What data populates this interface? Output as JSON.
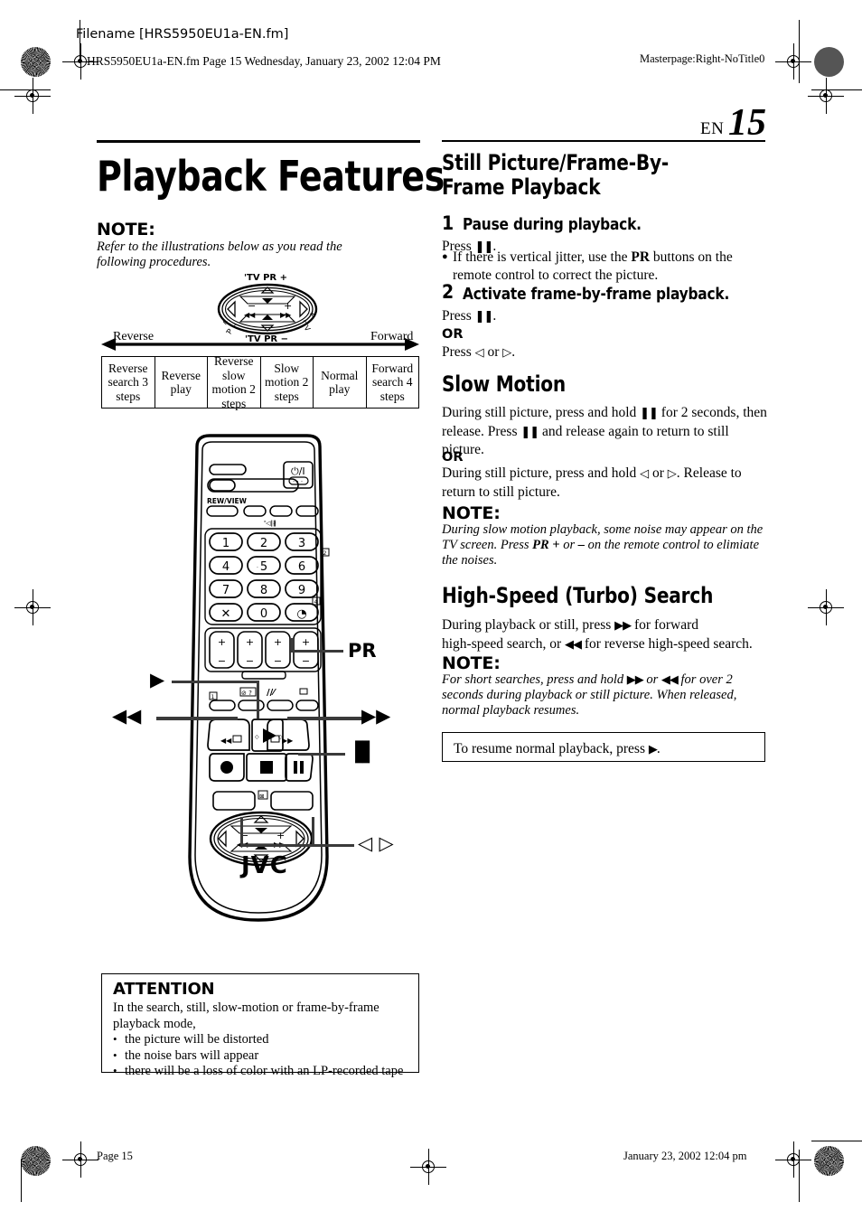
{
  "print_marks": {
    "header_filename": "Filename [HRS5950EU1a-EN.fm]",
    "header_fileinfo": "HRS5950EU1a-EN.fm  Page 15  Wednesday, January 23, 2002  12:04 PM",
    "header_masterpage": "Masterpage:Right-NoTitle0",
    "footer_page": "Page 15",
    "footer_date": "January 23, 2002 12:04 pm"
  },
  "page_header": {
    "lang": "EN",
    "page_number": "15"
  },
  "left_column": {
    "title": "Playback Features",
    "note_heading": "NOTE:",
    "note_body": "Refer to the illustrations below as you read the following procedures.",
    "diagram": {
      "pad_labels_top": "'TV PR +",
      "pad_labels_bottom": "'TV PR –",
      "pad_left_minus": "–",
      "pad_right_plus": "+",
      "axis_left_label": "Reverse",
      "axis_right_label": "Forward",
      "table_cells": [
        "Reverse search 3 steps",
        "Reverse play",
        "Reverse slow motion 2 steps",
        "Slow motion 2 steps",
        "Normal play",
        "Forward search 4 steps"
      ]
    },
    "remote": {
      "brand": "JVC",
      "keypad": [
        "1",
        "2",
        "3",
        "4",
        "5",
        "6",
        "7",
        "8",
        "9",
        "✕",
        "0",
        "◔"
      ],
      "label_rewind": "◀◀",
      "label_play": "▶",
      "label_pr": "PR",
      "label_forward": "▶▶",
      "label_pause": "▐▌",
      "label_leftright": "◁ ▷",
      "power_glyph": "⏻/I",
      "rewview_label": "REW/VIEW"
    },
    "attention": {
      "title": "ATTENTION",
      "intro": "In the search, still, slow-motion or frame-by-frame playback mode,",
      "bullets": [
        "the picture will be distorted",
        "the noise bars will appear",
        "there will be a loss of color with an LP-recorded tape"
      ]
    }
  },
  "right_column": {
    "sections": [
      {
        "heading": "Still Picture/Frame-By-Frame Playback",
        "steps": [
          {
            "number": "1",
            "title": "Pause during playback.",
            "lines": [
              "Press ▐▌.",
              "• If there is vertical jitter, use the PR buttons on the remote control to correct the picture."
            ]
          },
          {
            "number": "2",
            "title": "Activate frame-by-frame playback.",
            "lines": [
              "Press ▐▌.",
              "OR",
              "Press ◁ or ▷."
            ]
          }
        ]
      },
      {
        "heading": "Slow Motion",
        "paragraph_1": "During still picture, press and hold ▐▌ for 2 seconds, then release. Press ▐▌ and release again to return to still picture.",
        "or_label": "OR",
        "paragraph_2": "During still picture, press and hold ◁ or ▷. Release to return to still picture.",
        "note_heading": "NOTE:",
        "note_body": "During slow motion playback, some noise may appear on the TV screen. Press PR + or – on the remote control to elimiate the noises."
      },
      {
        "heading": "High-Speed (Turbo) Search",
        "paragraph_1": "During playback or still, press ▶▶ for forward high-speed search, or ◀◀ for reverse high-speed search.",
        "note_heading": "NOTE:",
        "note_body": "For short searches, press and hold ▶▶ or ◀◀ for over 2 seconds during playback or still picture. When released, normal playback resumes.",
        "resume_box": "To resume normal playback, press ▶."
      }
    ]
  },
  "colors": {
    "ink": "#000000",
    "leader": "#3a3a3a"
  }
}
